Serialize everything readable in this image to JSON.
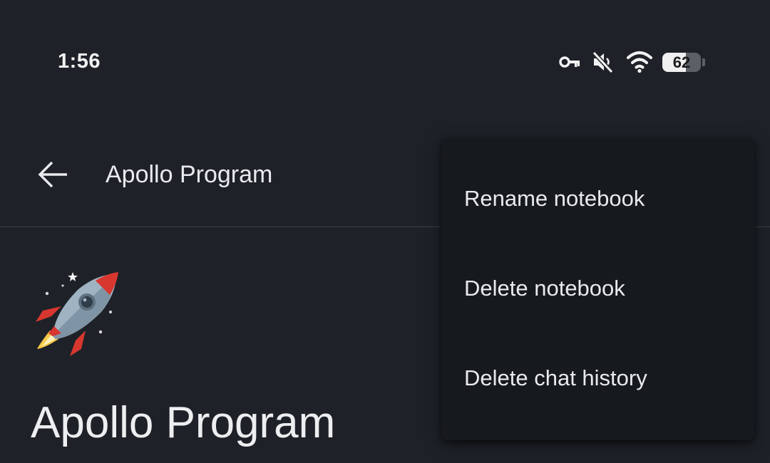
{
  "status_bar": {
    "time": "1:56",
    "battery_level": "62",
    "icons": [
      "vpn-key-icon",
      "muted-icon",
      "wifi-icon",
      "battery-icon"
    ]
  },
  "app_bar": {
    "back_icon": "arrow-back-icon",
    "title": "Apollo Program"
  },
  "notebook": {
    "emoji": "rocket-icon",
    "title": "Apollo Program"
  },
  "menu": {
    "items": [
      {
        "label": "Rename notebook"
      },
      {
        "label": "Delete notebook"
      },
      {
        "label": "Delete chat history"
      }
    ]
  },
  "colors": {
    "background": "#1e2228",
    "menu_background": "#16191d",
    "text": "#e8eaed"
  }
}
